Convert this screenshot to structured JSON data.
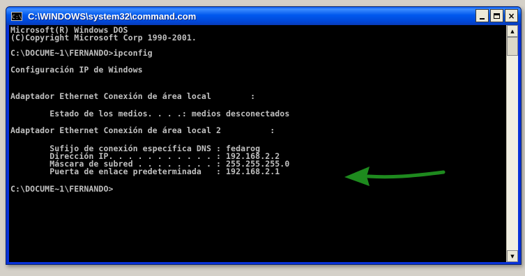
{
  "window": {
    "title": "C:\\WINDOWS\\system32\\command.com",
    "icon": "cmd-icon",
    "controls": {
      "minimize": "minimize-icon",
      "maximize": "maximize-icon",
      "close": "×"
    }
  },
  "console": {
    "lines": [
      "Microsoft(R) Windows DOS",
      "(C)Copyright Microsoft Corp 1990-2001.",
      "C:\\DOCUME~1\\FERNANDO>ipconfig",
      "Configuración IP de Windows",
      "Adaptador Ethernet Conexión de área local        :",
      "        Estado de los medios. . . .: medios desconectados",
      "Adaptador Ethernet Conexión de área local 2          :",
      "        Sufijo de conexión específica DNS : fedarog",
      "        Dirección IP. . . . . . . . . . . : 192.168.2.2",
      "        Máscara de subred . . . . . . . . : 255.255.255.0",
      "        Puerta de enlace predeterminada   : 192.168.2.1",
      "C:\\DOCUME~1\\FERNANDO>"
    ]
  },
  "annotation": {
    "arrow_color": "#1e8a1e",
    "arrow_icon": "green-arrow-icon"
  },
  "colors": {
    "console_bg": "#000000",
    "console_text": "#c0c0c0",
    "titlebar": "#0058ee"
  }
}
